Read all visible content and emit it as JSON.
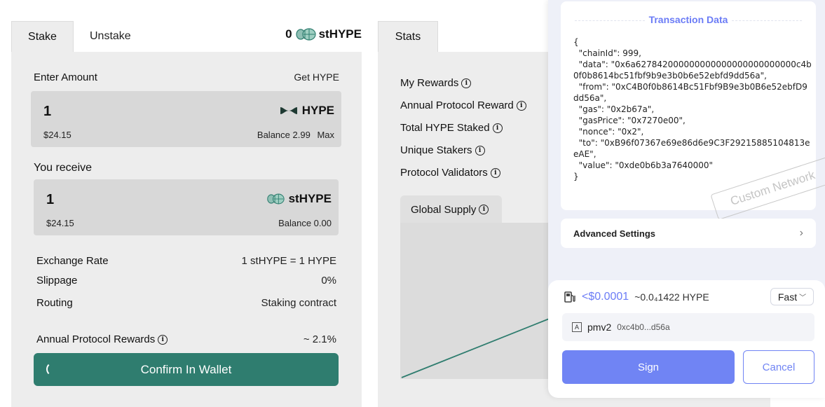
{
  "stake": {
    "tabs": {
      "stake": "Stake",
      "unstake": "Unstake"
    },
    "header_balance": {
      "amount": "0",
      "token": "stHYPE"
    },
    "enter_amount_label": "Enter Amount",
    "get_hype_link": "Get HYPE",
    "input": {
      "value": "1",
      "token": "HYPE",
      "usd": "$24.15",
      "balance_label": "Balance 2.99",
      "max": "Max"
    },
    "receive_label": "You receive",
    "output": {
      "value": "1",
      "token": "stHYPE",
      "usd": "$24.15",
      "balance_label": "Balance 0.00"
    },
    "details": [
      {
        "label": "Exchange Rate",
        "value": "1 stHYPE = 1 HYPE"
      },
      {
        "label": "Slippage",
        "value": "0%"
      },
      {
        "label": "Routing",
        "value": "Staking contract"
      }
    ],
    "annual_rewards": {
      "label": "Annual Protocol Rewards",
      "value": "~ 2.1%"
    },
    "confirm_button": "Confirm In Wallet"
  },
  "stats": {
    "tab": "Stats",
    "rows": [
      "My Rewards",
      "Annual Protocol Reward",
      "Total HYPE Staked",
      "Unique Stakers",
      "Protocol Validators"
    ],
    "supply_tab": "Global Supply"
  },
  "wallet": {
    "tx_title": "Transaction Data",
    "tx_json": "{\n  \"chainId\": 999,\n  \"data\": \"0x6a627842000000000000000000000000c4b0f0b8614bc51fbf9b9e3b0b6e52ebfd9dd56a\",\n  \"from\": \"0xC4B0f0b8614Bc51Fbf9B9e3b0B6e52ebfD9dd56a\",\n  \"gas\": \"0x2b67a\",\n  \"gasPrice\": \"0x7270e00\",\n  \"nonce\": \"0x2\",\n  \"to\": \"0xB96f07367e69e86d6e9C3F29215885104813eeAE\",\n  \"value\": \"0xde0b6b3a7640000\"\n}",
    "watermark": "Custom Network",
    "advanced_settings": "Advanced Settings",
    "fee_usd": "<$0.0001",
    "fee_hype": "~0.0₄1422 HYPE",
    "speed": "Fast",
    "account_badge": "A",
    "account_name": "pmv2",
    "account_address": "0xc4b0...d56a",
    "sign_button": "Sign",
    "cancel_button": "Cancel"
  },
  "colors": {
    "accent_green": "#2f7d6f",
    "wallet_accent": "#7084f4",
    "panel_bg": "#ededed"
  }
}
